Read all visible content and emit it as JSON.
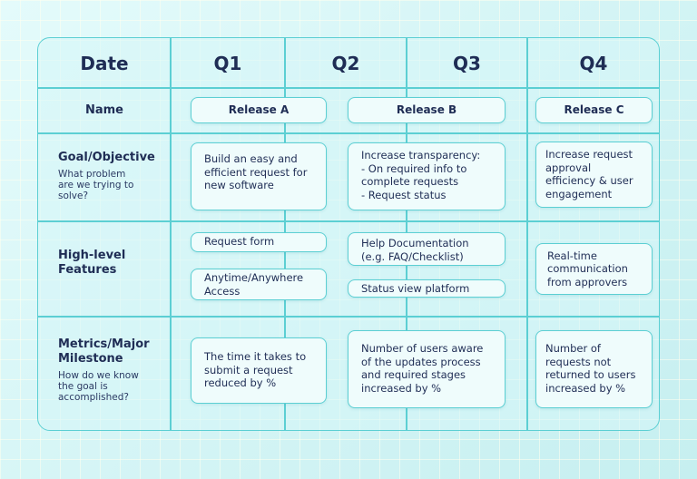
{
  "header": {
    "date_label": "Date",
    "quarters": [
      "Q1",
      "Q2",
      "Q3",
      "Q4"
    ]
  },
  "rows": {
    "name": {
      "title": "Name"
    },
    "goal": {
      "title": "Goal/Objective",
      "subtitle": "What problem are we trying to solve?"
    },
    "features": {
      "title": "High-level Features"
    },
    "metrics": {
      "title": "Metrics/Major Milestone",
      "subtitle": "How do we know the goal is accomplished?"
    }
  },
  "releases": [
    {
      "name": "Release A",
      "goal": "Build an easy and efficient request for new software",
      "features": [
        "Request form",
        "Anytime/Anywhere Access"
      ],
      "metric": "The time it takes to submit a request reduced by %"
    },
    {
      "name": "Release B",
      "goal_lines": [
        "Increase transparency:",
        "- On required info to complete requests",
        "- Request status"
      ],
      "features": [
        "Help Documentation (e.g. FAQ/Checklist)",
        "Status view platform"
      ],
      "metric": "Number of users aware of the updates process and required stages increased by %"
    },
    {
      "name": "Release C",
      "goal": "Increase request approval efficiency & user engagement",
      "features": [
        "Real-time communication from approvers"
      ],
      "metric": "Number of requests not returned to users increased by %"
    }
  ],
  "colors": {
    "line": "#5ccfd3",
    "text": "#1f2d55",
    "card": "#effcfc",
    "background": "#d9f6f7"
  }
}
